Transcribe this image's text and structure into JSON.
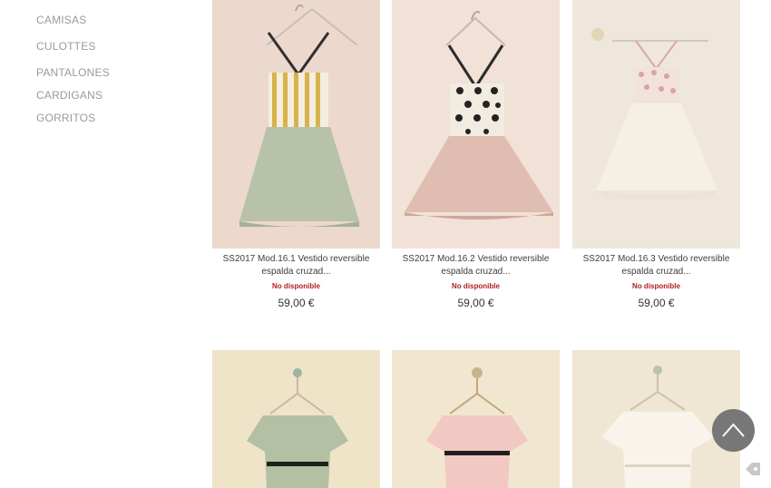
{
  "sidebar": {
    "items": [
      {
        "label": "CAMISAS"
      },
      {
        "label": "CULOTTES"
      },
      {
        "label": "PANTALONES"
      },
      {
        "label": "CARDIGANS"
      },
      {
        "label": "GORRITOS"
      }
    ]
  },
  "products": [
    {
      "name": "SS2017 Mod.16.1 Vestido reversible espalda cruzad...",
      "availability": "No disponible",
      "price": "59,00 €"
    },
    {
      "name": "SS2017 Mod.16.2 Vestido reversible espalda cruzad...",
      "availability": "No disponible",
      "price": "59,00 €"
    },
    {
      "name": "SS2017 Mod.16.3 Vestido reversible espalda cruzad...",
      "availability": "No disponible",
      "price": "59,00 €"
    }
  ],
  "colors": {
    "accent_unavailable": "#b02020",
    "sidebar_text": "#9a9a9a",
    "back_to_top": "#777777"
  },
  "icons": {
    "back_to_top": "chevron-up-icon",
    "floating": "tag-icon"
  }
}
